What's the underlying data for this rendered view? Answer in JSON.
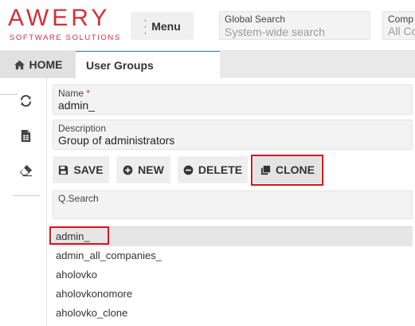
{
  "header": {
    "logo_text": "AWERY",
    "logo_subtitle": "SOFTWARE SOLUTIONS",
    "menu_label": "Menu",
    "global_search": {
      "label": "Global Search",
      "placeholder": "System-wide search",
      "value": ""
    },
    "company": {
      "label": "Comp",
      "value": "All Co"
    }
  },
  "tabs": [
    {
      "label": "HOME",
      "icon": "home-icon"
    },
    {
      "label": "User Groups",
      "active": true
    }
  ],
  "toolbar": {
    "items": [
      {
        "name": "refresh-icon"
      },
      {
        "name": "spreadsheet-icon"
      },
      {
        "name": "eraser-icon"
      }
    ]
  },
  "form": {
    "name": {
      "label": "Name",
      "required_mark": "*",
      "value": "admin_"
    },
    "description": {
      "label": "Description",
      "value": "Group of administrators"
    }
  },
  "actions": {
    "save": "SAVE",
    "new": "NEW",
    "delete": "DELETE",
    "clone": "CLONE"
  },
  "qsearch": {
    "label": "Q.Search",
    "value": ""
  },
  "list": {
    "items": [
      {
        "label": "admin_",
        "selected": true
      },
      {
        "label": "admin_all_companies_"
      },
      {
        "label": "aholovko"
      },
      {
        "label": "aholovkonomore"
      },
      {
        "label": "aholovko_clone"
      }
    ]
  },
  "colors": {
    "brand": "#d0323a",
    "highlight": "#d9141c",
    "active_tab_border": "#2e8bd6"
  }
}
